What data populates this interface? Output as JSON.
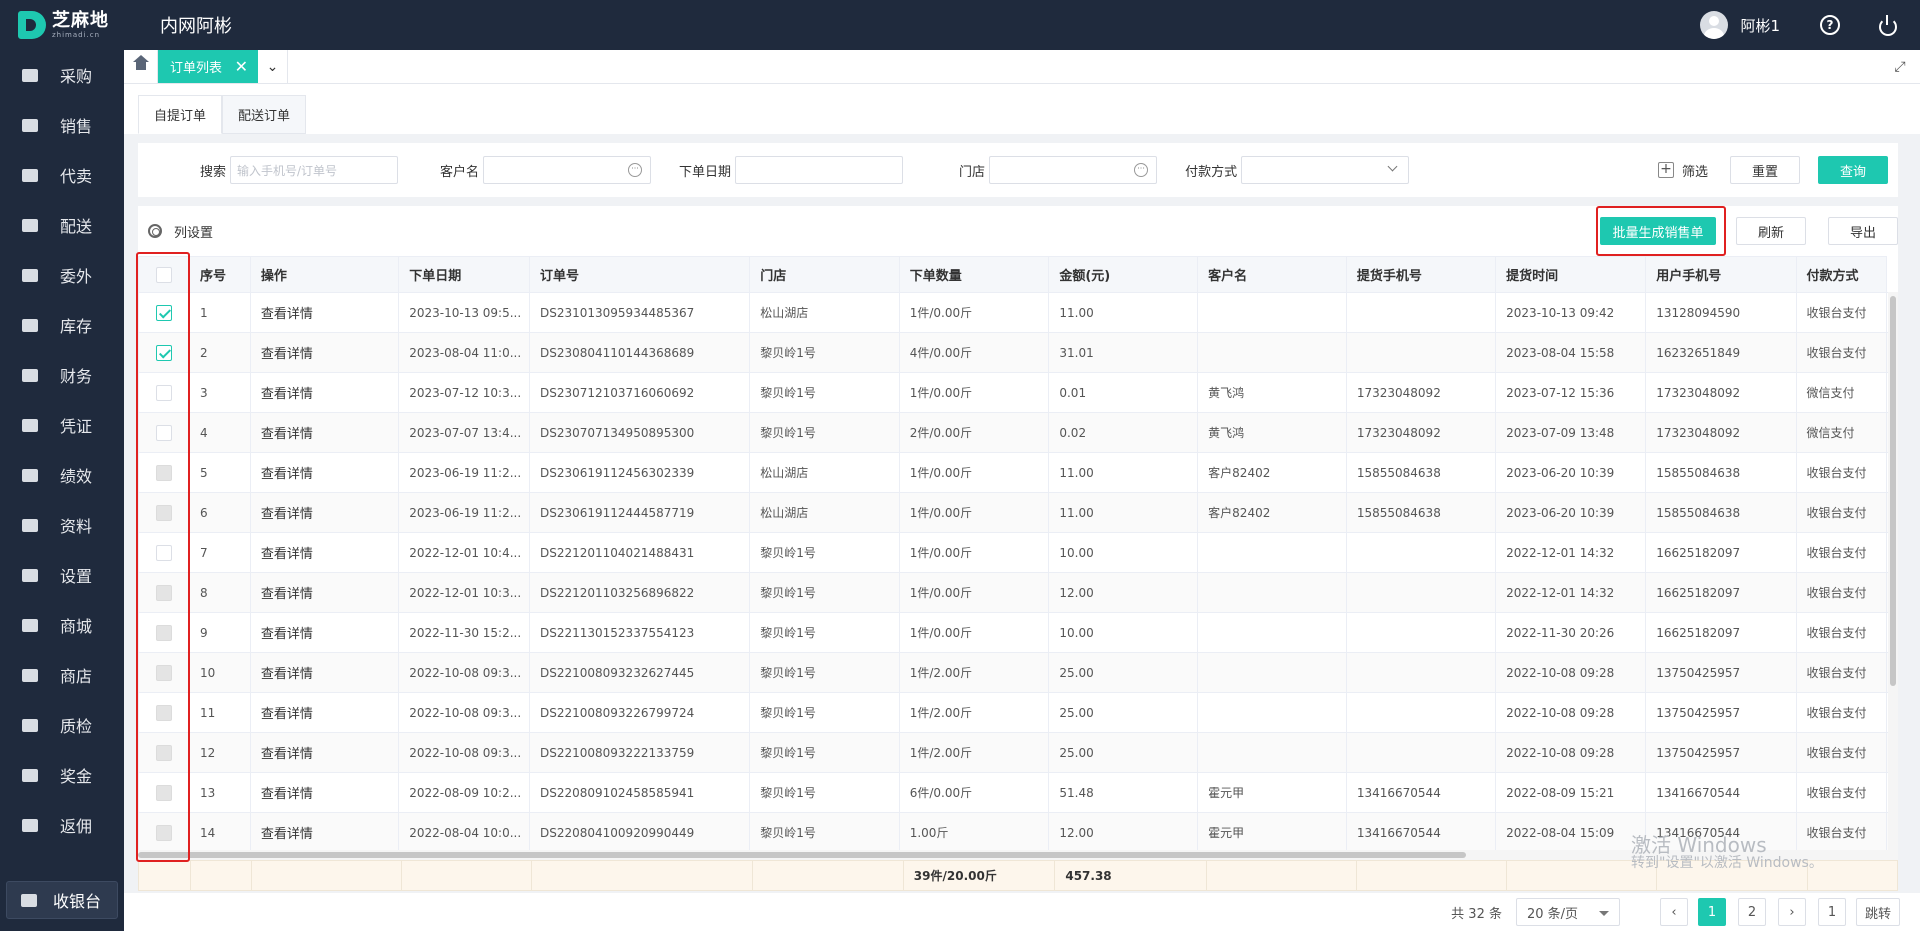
{
  "app": {
    "logo_cn": "芝麻地",
    "logo_en": "zhimadi.cn",
    "title": "内网阿彬",
    "username": "阿彬1",
    "accent": "#1ec8b0",
    "help_icon": "?"
  },
  "sidebar": {
    "items": [
      {
        "label": "采购",
        "icon": "basket-icon"
      },
      {
        "label": "销售",
        "icon": "cart-icon"
      },
      {
        "label": "代卖",
        "icon": "tag-icon"
      },
      {
        "label": "配送",
        "icon": "truck-icon"
      },
      {
        "label": "委外",
        "icon": "building-icon"
      },
      {
        "label": "库存",
        "icon": "warehouse-icon"
      },
      {
        "label": "财务",
        "icon": "yen-icon"
      },
      {
        "label": "凭证",
        "icon": "voucher-icon"
      },
      {
        "label": "绩效",
        "icon": "cart-icon"
      },
      {
        "label": "资料",
        "icon": "printer-icon"
      },
      {
        "label": "设置",
        "icon": "gear-icon"
      },
      {
        "label": "商城",
        "icon": "store-icon"
      },
      {
        "label": "商店",
        "icon": "shop-icon"
      },
      {
        "label": "质检",
        "icon": "basket-icon"
      },
      {
        "label": "奖金",
        "icon": "store-icon"
      },
      {
        "label": "返佣",
        "icon": "building-icon"
      }
    ],
    "cashier": "收银台"
  },
  "tabs": {
    "active": "订单列表",
    "close": "✕",
    "more": "⌄",
    "expand": "⤢"
  },
  "subtabs": [
    "自提订单",
    "配送订单"
  ],
  "filters": {
    "search_label": "搜索",
    "search_placeholder": "输入手机号/订单号",
    "customer_label": "客户名",
    "date_label": "下单日期",
    "store_label": "门店",
    "payment_label": "付款方式",
    "filter_label": "筛选",
    "reset": "重置",
    "query": "查询"
  },
  "toolbar": {
    "columns": "列设置",
    "batch": "批量生成销售单",
    "refresh": "刷新",
    "export": "导出"
  },
  "table": {
    "headers": [
      "序号",
      "操作",
      "下单日期",
      "订单号",
      "门店",
      "下单数量",
      "金额(元)",
      "客户名",
      "提货手机号",
      "提货时间",
      "用户手机号",
      "付款方式"
    ],
    "rows": [
      {
        "check": "checked",
        "no": "1",
        "op": "查看详情",
        "date": "2023-10-13 09:5...",
        "order": "DS231013095934485367",
        "store": "松山湖店",
        "qty": "1件/0.00斤",
        "amount": "11.00",
        "customer": "",
        "pick_phone": "",
        "pick_time": "2023-10-13 09:42",
        "user_phone": "13128094590",
        "pay": "收银台支付"
      },
      {
        "check": "checked",
        "no": "2",
        "op": "查看详情",
        "date": "2023-08-04 11:0...",
        "order": "DS230804110144368689",
        "store": "黎贝岭1号",
        "qty": "4件/0.00斤",
        "amount": "31.01",
        "customer": "",
        "pick_phone": "",
        "pick_time": "2023-08-04 15:58",
        "user_phone": "16232651849",
        "pay": "收银台支付"
      },
      {
        "check": "empty",
        "no": "3",
        "op": "查看详情",
        "date": "2023-07-12 10:3...",
        "order": "DS230712103716060692",
        "store": "黎贝岭1号",
        "qty": "1件/0.00斤",
        "amount": "0.01",
        "customer": "黄飞鸿",
        "pick_phone": "17323048092",
        "pick_time": "2023-07-12 15:36",
        "user_phone": "17323048092",
        "pay": "微信支付"
      },
      {
        "check": "empty",
        "no": "4",
        "op": "查看详情",
        "date": "2023-07-07 13:4...",
        "order": "DS230707134950895300",
        "store": "黎贝岭1号",
        "qty": "2件/0.00斤",
        "amount": "0.02",
        "customer": "黄飞鸿",
        "pick_phone": "17323048092",
        "pick_time": "2023-07-09 13:48",
        "user_phone": "17323048092",
        "pay": "微信支付"
      },
      {
        "check": "disabled",
        "no": "5",
        "op": "查看详情",
        "date": "2023-06-19 11:2...",
        "order": "DS230619112456302339",
        "store": "松山湖店",
        "qty": "1件/0.00斤",
        "amount": "11.00",
        "customer": "客户82402",
        "pick_phone": "15855084638",
        "pick_time": "2023-06-20 10:39",
        "user_phone": "15855084638",
        "pay": "收银台支付"
      },
      {
        "check": "disabled",
        "no": "6",
        "op": "查看详情",
        "date": "2023-06-19 11:2...",
        "order": "DS230619112444587719",
        "store": "松山湖店",
        "qty": "1件/0.00斤",
        "amount": "11.00",
        "customer": "客户82402",
        "pick_phone": "15855084638",
        "pick_time": "2023-06-20 10:39",
        "user_phone": "15855084638",
        "pay": "收银台支付"
      },
      {
        "check": "empty",
        "no": "7",
        "op": "查看详情",
        "date": "2022-12-01 10:4...",
        "order": "DS221201104021488431",
        "store": "黎贝岭1号",
        "qty": "1件/0.00斤",
        "amount": "10.00",
        "customer": "",
        "pick_phone": "",
        "pick_time": "2022-12-01 14:32",
        "user_phone": "16625182097",
        "pay": "收银台支付"
      },
      {
        "check": "disabled",
        "no": "8",
        "op": "查看详情",
        "date": "2022-12-01 10:3...",
        "order": "DS221201103256896822",
        "store": "黎贝岭1号",
        "qty": "1件/0.00斤",
        "amount": "12.00",
        "customer": "",
        "pick_phone": "",
        "pick_time": "2022-12-01 14:32",
        "user_phone": "16625182097",
        "pay": "收银台支付"
      },
      {
        "check": "disabled",
        "no": "9",
        "op": "查看详情",
        "date": "2022-11-30 15:2...",
        "order": "DS221130152337554123",
        "store": "黎贝岭1号",
        "qty": "1件/0.00斤",
        "amount": "10.00",
        "customer": "",
        "pick_phone": "",
        "pick_time": "2022-11-30 20:26",
        "user_phone": "16625182097",
        "pay": "收银台支付"
      },
      {
        "check": "disabled",
        "no": "10",
        "op": "查看详情",
        "date": "2022-10-08 09:3...",
        "order": "DS221008093232627445",
        "store": "黎贝岭1号",
        "qty": "1件/2.00斤",
        "amount": "25.00",
        "customer": "",
        "pick_phone": "",
        "pick_time": "2022-10-08 09:28",
        "user_phone": "13750425957",
        "pay": "收银台支付"
      },
      {
        "check": "disabled",
        "no": "11",
        "op": "查看详情",
        "date": "2022-10-08 09:3...",
        "order": "DS221008093226799724",
        "store": "黎贝岭1号",
        "qty": "1件/2.00斤",
        "amount": "25.00",
        "customer": "",
        "pick_phone": "",
        "pick_time": "2022-10-08 09:28",
        "user_phone": "13750425957",
        "pay": "收银台支付"
      },
      {
        "check": "disabled",
        "no": "12",
        "op": "查看详情",
        "date": "2022-10-08 09:3...",
        "order": "DS221008093222133759",
        "store": "黎贝岭1号",
        "qty": "1件/2.00斤",
        "amount": "25.00",
        "customer": "",
        "pick_phone": "",
        "pick_time": "2022-10-08 09:28",
        "user_phone": "13750425957",
        "pay": "收银台支付"
      },
      {
        "check": "disabled",
        "no": "13",
        "op": "查看详情",
        "date": "2022-08-09 10:2...",
        "order": "DS220809102458585941",
        "store": "黎贝岭1号",
        "qty": "6件/0.00斤",
        "amount": "51.48",
        "customer": "霍元甲",
        "pick_phone": "13416670544",
        "pick_time": "2022-08-09 15:21",
        "user_phone": "13416670544",
        "pay": "收银台支付"
      },
      {
        "check": "disabled",
        "no": "14",
        "op": "查看详情",
        "date": "2022-08-04 10:0...",
        "order": "DS220804100920990449",
        "store": "黎贝岭1号",
        "qty": "1.00斤",
        "amount": "12.00",
        "customer": "霍元甲",
        "pick_phone": "13416670544",
        "pick_time": "2022-08-04 15:09",
        "user_phone": "13416670544",
        "pay": "收银台支付"
      }
    ],
    "summary": {
      "qty": "39件/20.00斤",
      "amount": "457.38"
    }
  },
  "pager": {
    "total": "共 32 条",
    "page_size": "20 条/页",
    "prev": "‹",
    "pages": [
      "1",
      "2"
    ],
    "next": "›",
    "jump_value": "1",
    "jump": "跳转"
  },
  "watermark": {
    "line1": "激活 Windows",
    "line2": "转到\"设置\"以激活 Windows。"
  }
}
